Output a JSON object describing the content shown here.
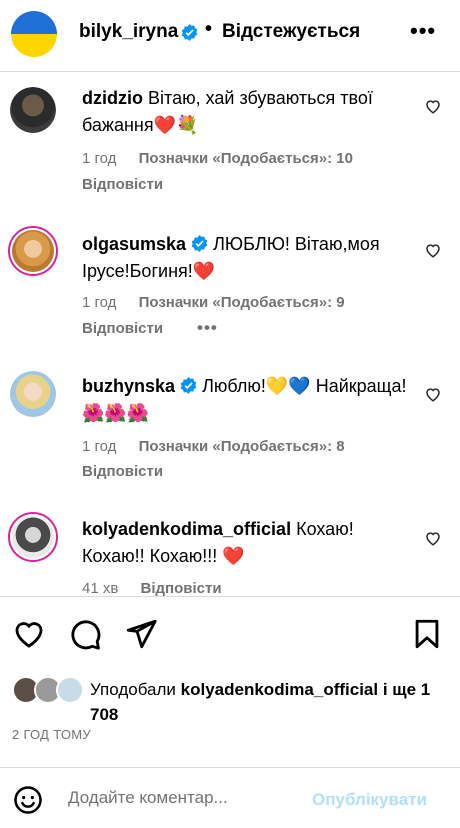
{
  "header": {
    "username": "bilyk_iryna",
    "separator": "•",
    "follow_status": "Відстежується",
    "more": "•••"
  },
  "comments": [
    {
      "username": "dzidzio",
      "text": "Вітаю, хай збуваються твої бажання❤️💐",
      "time": "1 год",
      "likes": "Позначки «Подобається»: 10",
      "reply": "Відповісти"
    },
    {
      "username": "olgasumska",
      "text": "ЛЮБЛЮ! Вітаю,моя Ірусе!Богиня!❤️",
      "time": "1 год",
      "likes": "Позначки «Подобається»: 9",
      "reply": "Відповісти",
      "more": "•••"
    },
    {
      "username": "buzhynska",
      "text": "Люблю!💛💙 Найкраща!🌺🌺🌺",
      "time": "1 год",
      "likes": "Позначки «Подобається»: 8",
      "reply": "Відповісти"
    },
    {
      "username": "kolyadenkodima_official",
      "text": "Кохаю! Кохаю!! Кохаю!!! ❤️",
      "time": "41 хв",
      "reply": "Відповісти"
    }
  ],
  "likes_summary": {
    "prefix": "Уподобали",
    "user": "kolyadenkodima_official",
    "suffix": "і ще 1 708"
  },
  "post_date": "2 ГОД ТОМУ",
  "comment_bar": {
    "placeholder": "Додайте коментар...",
    "publish": "Опублікувати"
  },
  "colors": {
    "accent_disabled": "#b2dffc",
    "verified": "#0095f6",
    "muted": "#737373",
    "flag_blue": "#1f6fd6",
    "flag_yellow": "#ffd500"
  }
}
